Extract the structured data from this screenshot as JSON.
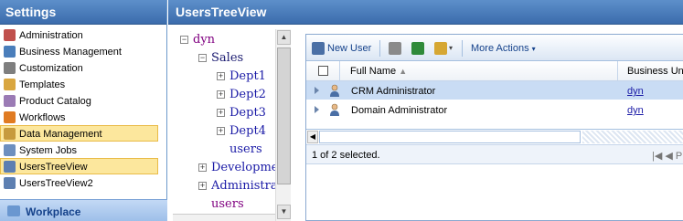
{
  "settings_pane": {
    "title": "Settings",
    "items": [
      {
        "label": "Administration",
        "icon": "administration-icon",
        "selected": false,
        "color": "#c0504d"
      },
      {
        "label": "Business Management",
        "icon": "business-management-icon",
        "selected": false,
        "color": "#4a7ebb"
      },
      {
        "label": "Customization",
        "icon": "customization-icon",
        "selected": false,
        "color": "#7f7f7f"
      },
      {
        "label": "Templates",
        "icon": "templates-icon",
        "selected": false,
        "color": "#d9a640"
      },
      {
        "label": "Product Catalog",
        "icon": "product-catalog-icon",
        "selected": false,
        "color": "#9b7bb5"
      },
      {
        "label": "Workflows",
        "icon": "workflows-icon",
        "selected": false,
        "color": "#e07b22"
      },
      {
        "label": "Data Management",
        "icon": "data-management-icon",
        "selected": true,
        "color": "#c79a3d"
      },
      {
        "label": "System Jobs",
        "icon": "system-jobs-icon",
        "selected": false,
        "color": "#6d8fbf"
      },
      {
        "label": "UsersTreeView",
        "icon": "users-tree-view-icon",
        "selected": true,
        "color": "#5d7fb1"
      },
      {
        "label": "UsersTreeView2",
        "icon": "users-tree-view2-icon",
        "selected": false,
        "color": "#5d7fb1"
      }
    ],
    "workplace_label": "Workplace"
  },
  "main": {
    "title": "UsersTreeView",
    "tree": [
      {
        "label": "dyn",
        "toggle": "⊟",
        "style": "purple"
      },
      {
        "label": "Sales",
        "toggle": "⊟",
        "style": "dark"
      },
      {
        "label": "Dept1",
        "toggle": "⊞",
        "style": "blue"
      },
      {
        "label": "Dept2",
        "toggle": "⊞",
        "style": "blue"
      },
      {
        "label": "Dept3",
        "toggle": "⊞",
        "style": "blue"
      },
      {
        "label": "Dept4",
        "toggle": "⊞",
        "style": "blue"
      },
      {
        "label": "users",
        "toggle": "",
        "style": "blue"
      },
      {
        "label": "Developmen",
        "toggle": "⊞",
        "style": "blue"
      },
      {
        "label": "Administrati",
        "toggle": "⊞",
        "style": "blue"
      },
      {
        "label": "users",
        "toggle": "",
        "style": "purple"
      }
    ],
    "toolbar": {
      "new_user_label": "New User",
      "more_actions_label": "More Actions"
    },
    "grid": {
      "columns": [
        "Full Name",
        "Business Unit"
      ],
      "sort_indicator": "▲",
      "rows": [
        {
          "full_name": "CRM Administrator",
          "business_unit": "dyn",
          "selected": true
        },
        {
          "full_name": "Domain Administrator",
          "business_unit": "dyn",
          "selected": false
        }
      ],
      "status": "1 of 2 selected.",
      "pager_text": "|◀ ◀ P"
    }
  },
  "colors": {
    "header_blue": "#4a7dbd",
    "selected_nav": "#fce79d",
    "selected_row": "#c9dcf4",
    "link_blue": "#1a1aa6",
    "tree_purple": "#800080"
  }
}
